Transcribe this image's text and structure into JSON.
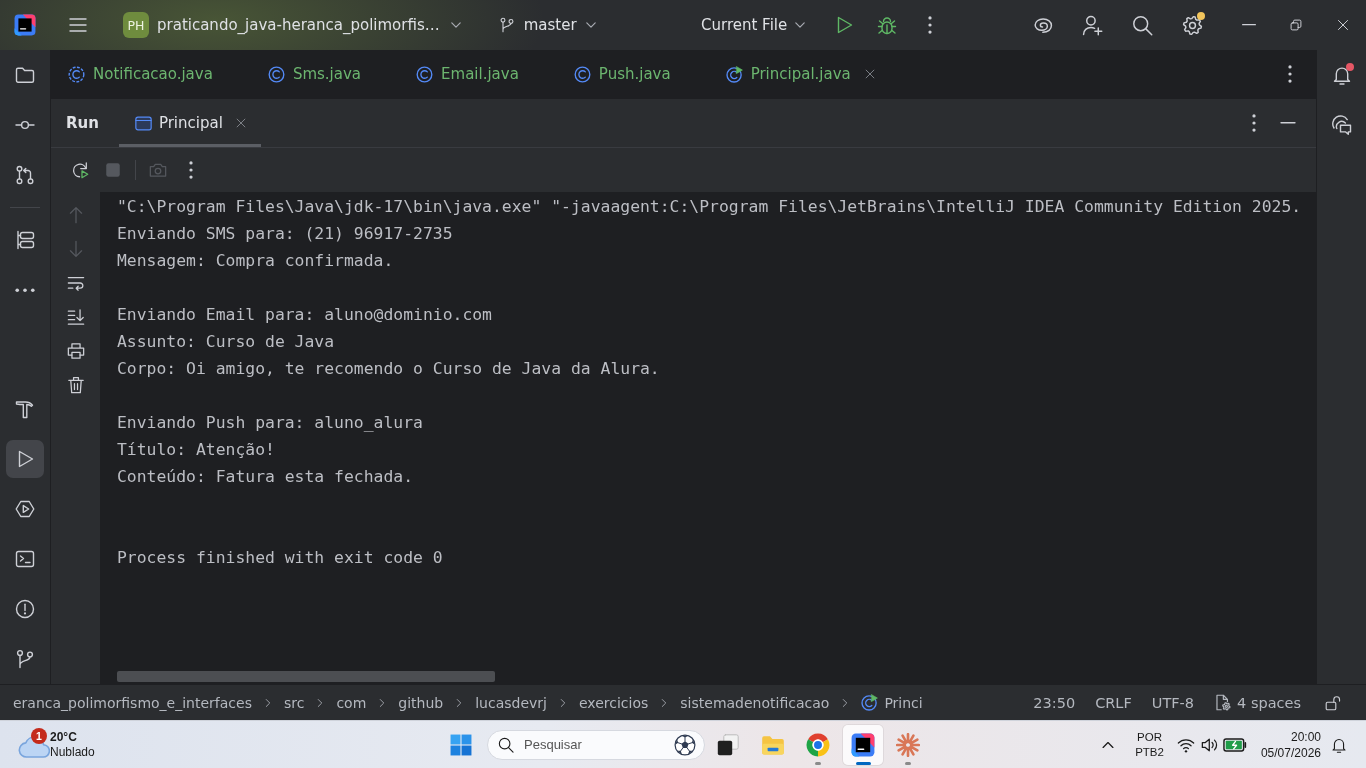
{
  "title_bar": {
    "project": {
      "initials": "PH",
      "name": "praticando_java-heranca_polimorfis…"
    },
    "branch": "master",
    "run_configuration": "Current File",
    "actions": [
      {
        "kind": "ai_assistant",
        "badge": false
      },
      {
        "kind": "code_with_me",
        "badge": false
      },
      {
        "kind": "search",
        "badge": false
      },
      {
        "kind": "settings",
        "badge": true
      }
    ]
  },
  "tool_strip": {
    "top_groups": [
      [
        {
          "kind": "project",
          "selected": false
        },
        {
          "kind": "commit",
          "selected": false
        },
        {
          "kind": "pull_requests",
          "selected": false
        }
      ],
      [
        {
          "kind": "structure",
          "selected": false
        },
        {
          "kind": "more",
          "selected": false
        }
      ]
    ],
    "bottom": [
      {
        "kind": "build",
        "selected": false
      },
      {
        "kind": "run",
        "selected": true
      },
      {
        "kind": "services",
        "selected": false
      },
      {
        "kind": "terminal",
        "selected": false
      },
      {
        "kind": "problems",
        "selected": false
      },
      {
        "kind": "git",
        "selected": false
      }
    ]
  },
  "editor_tabs": [
    {
      "label": "Notificacao.java",
      "kind": "abstract_class",
      "selected": false
    },
    {
      "label": "Sms.java",
      "kind": "class",
      "selected": false
    },
    {
      "label": "Email.java",
      "kind": "class",
      "selected": false
    },
    {
      "label": "Push.java",
      "kind": "class",
      "selected": false
    },
    {
      "label": "Principal.java",
      "kind": "runnable_class",
      "selected": true
    }
  ],
  "run_panel": {
    "title": "Run",
    "tabs": [
      {
        "label": "Principal",
        "selected": true
      }
    ],
    "toolbar": [
      [
        {
          "kind": "rerun",
          "disabled": false
        },
        {
          "kind": "stop",
          "disabled": true
        }
      ],
      [
        {
          "kind": "screenshot",
          "disabled": true
        },
        {
          "kind": "more_actions",
          "disabled": false
        }
      ]
    ],
    "side_toolbar": [
      {
        "kind": "up",
        "disabled": true
      },
      {
        "kind": "down",
        "disabled": true
      },
      {
        "kind": "soft_wrap",
        "disabled": false
      },
      {
        "kind": "scroll_to_end",
        "disabled": false
      },
      {
        "kind": "print",
        "disabled": false
      },
      {
        "kind": "clear",
        "disabled": false
      }
    ],
    "console": {
      "command": "\"C:\\Program Files\\Java\\jdk-17\\bin\\java.exe\" \"-javaagent:C:\\Program Files\\JetBrains\\IntelliJ IDEA Community Edition 2025.",
      "output_blocks": [
        [
          "Enviando SMS para: (21) 96917-2735",
          "Mensagem: Compra confirmada."
        ],
        [
          "Enviando Email para: aluno@dominio.com",
          "Assunto: Curso de Java",
          "Corpo: Oi amigo, te recomendo o Curso de Java da Alura."
        ],
        [
          "Enviando Push para: aluno_alura",
          "Título: Atenção!",
          "Conteúdo: Fatura esta fechada."
        ]
      ],
      "exit_message": "Process finished with exit code 0"
    }
  },
  "right_strip": [
    {
      "kind": "notifications",
      "badge": true
    },
    {
      "kind": "ai_chat",
      "badge": false
    }
  ],
  "breadcrumbs": [
    {
      "label": "eranca_polimorfismo_e_interfaces",
      "kind": "folder"
    },
    {
      "label": "src",
      "kind": "folder"
    },
    {
      "label": "com",
      "kind": "folder"
    },
    {
      "label": "github",
      "kind": "folder"
    },
    {
      "label": "lucasdevrj",
      "kind": "folder"
    },
    {
      "label": "exercicios",
      "kind": "folder"
    },
    {
      "label": "sistemadenotificacao",
      "kind": "folder"
    },
    {
      "label": "Princi",
      "kind": "runnable_class"
    }
  ],
  "status_bar": {
    "position": "23:50",
    "line_separator": "CRLF",
    "encoding": "UTF-8",
    "indent": "4 spaces",
    "read_only": false
  },
  "taskbar": {
    "weather": {
      "temperature": "20°C",
      "condition": "Nublado",
      "badge": "1"
    },
    "search": {
      "placeholder": "Pesquisar"
    },
    "apps": [
      {
        "kind": "squares",
        "running": false,
        "selected": false
      },
      {
        "kind": "file_explorer",
        "running": false,
        "selected": false
      },
      {
        "kind": "browser",
        "running": true,
        "selected": false
      },
      {
        "kind": "ide",
        "running": true,
        "selected": true
      },
      {
        "kind": "asterisk",
        "running": true,
        "selected": false
      }
    ],
    "tray": {
      "language": "POR",
      "layout": "PTB2"
    },
    "clock": {
      "time": "20:00",
      "date": "05/07/2026"
    }
  }
}
